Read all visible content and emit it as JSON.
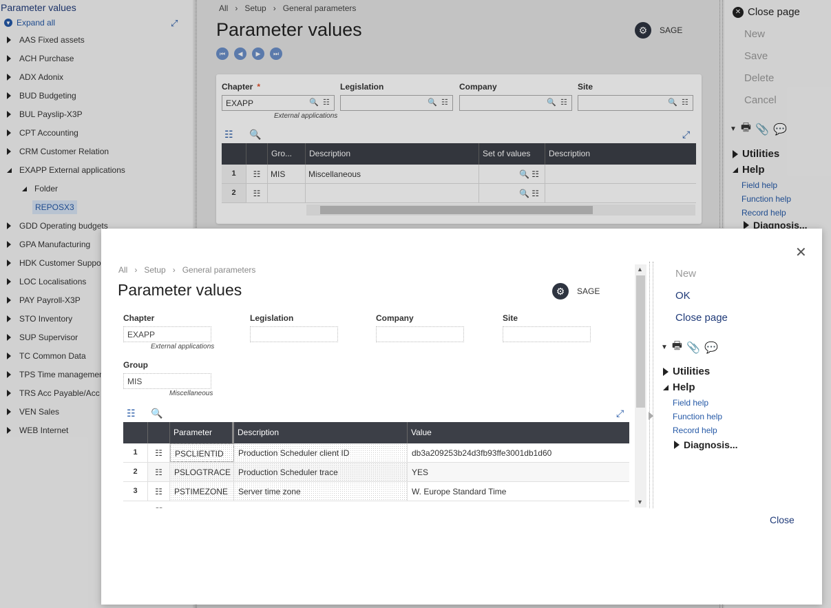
{
  "tree": {
    "title": "Parameter values",
    "expand_all": "Expand all",
    "items": [
      {
        "label": "AAS Fixed assets"
      },
      {
        "label": "ACH Purchase"
      },
      {
        "label": "ADX Adonix"
      },
      {
        "label": "BUD Budgeting"
      },
      {
        "label": "BUL Payslip-X3P"
      },
      {
        "label": "CPT Accounting"
      },
      {
        "label": "CRM Customer Relation"
      },
      {
        "label": "EXAPP External applications"
      },
      {
        "label": "Folder"
      },
      {
        "label": "REPOSX3"
      },
      {
        "label": "GDD Operating budgets"
      },
      {
        "label": "GPA Manufacturing"
      },
      {
        "label": "HDK Customer Support"
      },
      {
        "label": "LOC Localisations"
      },
      {
        "label": "PAY Payroll-X3P"
      },
      {
        "label": "STO Inventory"
      },
      {
        "label": "SUP Supervisor"
      },
      {
        "label": "TC Common Data"
      },
      {
        "label": "TPS Time management"
      },
      {
        "label": "TRS Acc Payable/Acc"
      },
      {
        "label": "VEN Sales"
      },
      {
        "label": "WEB Internet"
      }
    ]
  },
  "breadcrumb": [
    "All",
    "Setup",
    "General parameters"
  ],
  "page": {
    "title": "Parameter values",
    "sage_label": "SAGE",
    "fields": {
      "chapter_label": "Chapter",
      "chapter_value": "EXAPP",
      "chapter_hint": "External applications",
      "legislation_label": "Legislation",
      "company_label": "Company",
      "site_label": "Site"
    },
    "grid": {
      "headers": [
        "Gro...",
        "Description",
        "Set of values",
        "Description"
      ],
      "rows": [
        {
          "num": "1",
          "group": "MIS",
          "description": "Miscellaneous"
        },
        {
          "num": "2",
          "group": "",
          "description": ""
        }
      ]
    }
  },
  "right_panel": {
    "close_page": "Close page",
    "actions": [
      "New",
      "Save",
      "Delete",
      "Cancel"
    ],
    "utilities": "Utilities",
    "help": "Help",
    "help_links": [
      "Field help",
      "Function help",
      "Record help"
    ],
    "diagnosis": "Diagnosis..."
  },
  "modal": {
    "breadcrumb": [
      "All",
      "Setup",
      "General parameters"
    ],
    "title": "Parameter values",
    "sage_label": "SAGE",
    "fields": {
      "chapter_label": "Chapter",
      "chapter_value": "EXAPP",
      "chapter_hint": "External applications",
      "legislation_label": "Legislation",
      "company_label": "Company",
      "site_label": "Site",
      "group_label": "Group",
      "group_value": "MIS",
      "group_hint": "Miscellaneous"
    },
    "grid": {
      "headers": [
        "Parameter",
        "Description",
        "Value"
      ],
      "rows": [
        {
          "num": "1",
          "parameter": "PSCLIENTID",
          "description": "Production Scheduler client ID",
          "value": "db3a209253b24d3fb93ffe3001db1d60"
        },
        {
          "num": "2",
          "parameter": "PSLOGTRACE",
          "description": "Production Scheduler trace",
          "value": "YES"
        },
        {
          "num": "3",
          "parameter": "PSTIMEZONE",
          "description": "Server time zone",
          "value": "W. Europe Standard Time"
        }
      ]
    },
    "actions": {
      "new": "New",
      "ok": "OK",
      "close_page": "Close page"
    },
    "utilities": "Utilities",
    "help": "Help",
    "help_links": [
      "Field help",
      "Function help",
      "Record help"
    ],
    "diagnosis": "Diagnosis...",
    "close_button": "Close"
  },
  "colors": {
    "accent": "#2458a6",
    "header_dark": "#3c3f47",
    "disabled": "#9a9a9a"
  }
}
